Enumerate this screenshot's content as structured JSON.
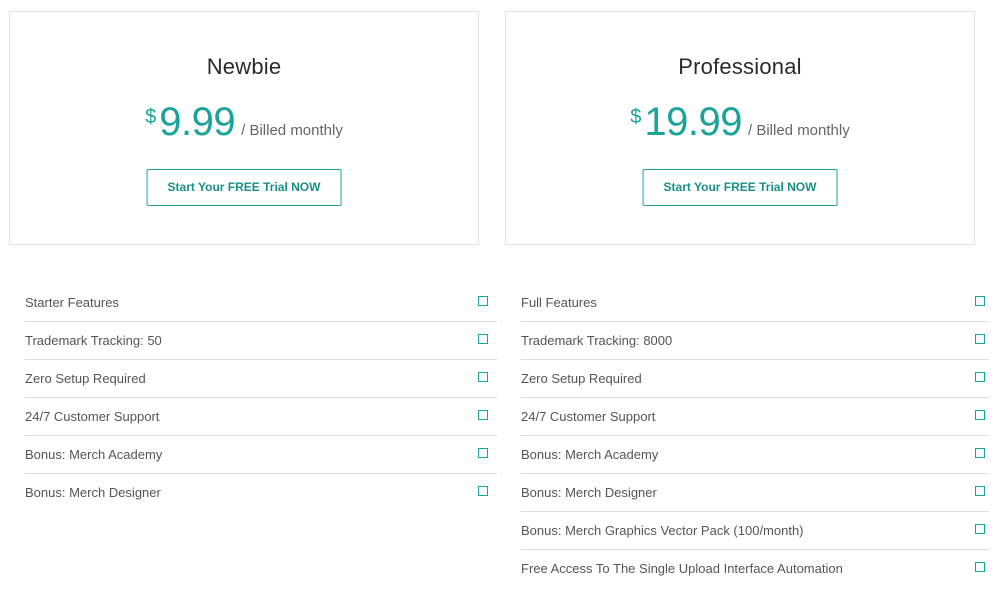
{
  "plans": [
    {
      "name": "Newbie",
      "currency": "$",
      "amount": "9.99",
      "billing": "/ Billed monthly",
      "cta_label": "Start Your FREE Trial NOW",
      "features": [
        "Starter Features",
        "Trademark Tracking: 50",
        "Zero Setup Required",
        "24/7 Customer Support",
        "Bonus: Merch Academy",
        "Bonus: Merch Designer"
      ]
    },
    {
      "name": "Professional",
      "currency": "$",
      "amount": "19.99",
      "billing": "/ Billed monthly",
      "cta_label": "Start Your FREE Trial NOW",
      "features": [
        "Full Features",
        "Trademark Tracking: 8000",
        "Zero Setup Required",
        "24/7 Customer Support",
        "Bonus: Merch Academy",
        "Bonus: Merch Designer",
        "Bonus: Merch Graphics Vector Pack (100/month)",
        "Free Access To The Single Upload Interface Automation"
      ]
    }
  ],
  "icons": {
    "feature_check": "checkbox-square-icon"
  },
  "colors": {
    "accent": "#1aa39a",
    "title": "#2b2b2b",
    "text": "#555555",
    "border": "#e2e2e2"
  }
}
